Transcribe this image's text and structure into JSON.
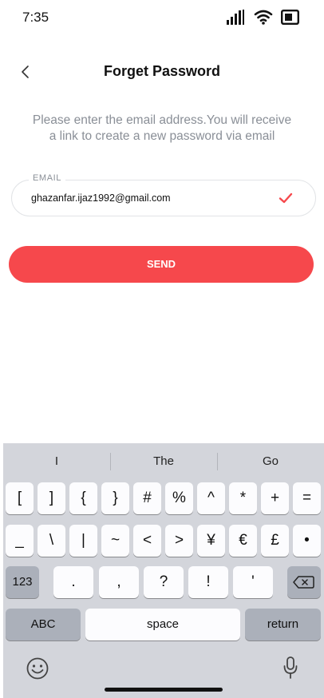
{
  "status_bar": {
    "time": "7:35"
  },
  "header": {
    "title": "Forget Password"
  },
  "instructions": {
    "line1": "Please enter the email address.You will receive",
    "line2": "a link to create a new password via email"
  },
  "email_field": {
    "label": "EMAIL",
    "value": "ghazanfar.ijaz1992@gmail.com"
  },
  "send_button": {
    "label": "SEND"
  },
  "keyboard": {
    "suggestions": [
      "I",
      "The",
      "Go"
    ],
    "row1": [
      "[",
      "]",
      "{",
      "}",
      "#",
      "%",
      "^",
      "*",
      "+",
      "="
    ],
    "row2": [
      "_",
      "\\",
      "|",
      "~",
      "<",
      ">",
      "¥",
      "€",
      "£",
      "•"
    ],
    "row3": {
      "mode_key": "123",
      "keys": [
        ".",
        ",",
        "?",
        "!",
        "'"
      ],
      "delete_icon": "backspace-icon"
    },
    "row4": {
      "abc": "ABC",
      "space": "space",
      "return": "return"
    },
    "bottom_icons": [
      "emoji-icon",
      "microphone-icon"
    ]
  },
  "colors": {
    "accent": "#f6484c",
    "keyboard_bg": "#d3d5db",
    "muted_text": "#8a8f97"
  }
}
